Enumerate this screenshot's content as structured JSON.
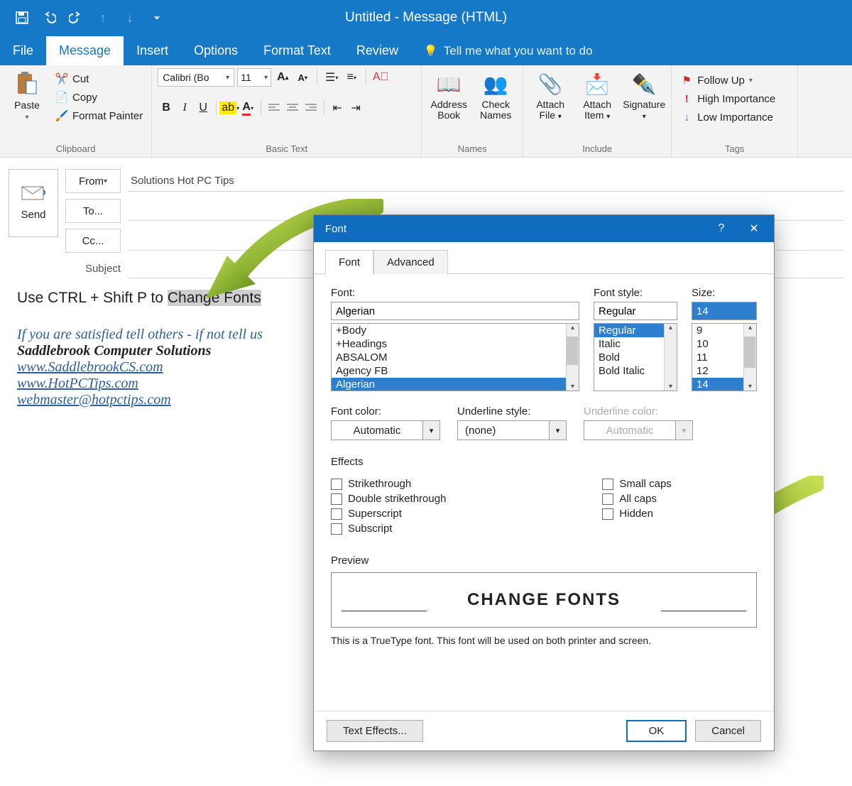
{
  "window": {
    "title": "Untitled - Message (HTML)"
  },
  "tabs": {
    "file": "File",
    "message": "Message",
    "insert": "Insert",
    "options": "Options",
    "format_text": "Format Text",
    "review": "Review",
    "tell_me": "Tell me what you want to do"
  },
  "ribbon": {
    "paste": "Paste",
    "cut": "Cut",
    "copy": "Copy",
    "format_painter": "Format Painter",
    "clipboard_label": "Clipboard",
    "font_name": "Calibri (Bo",
    "font_size": "11",
    "basic_text_label": "Basic Text",
    "address_book": "Address Book",
    "check_names": "Check Names",
    "names_label": "Names",
    "attach_file": "Attach File",
    "attach_item": "Attach Item",
    "signature": "Signature",
    "include_label": "Include",
    "follow_up": "Follow Up",
    "high_importance": "High Importance",
    "low_importance": "Low Importance",
    "tags_label": "Tags"
  },
  "compose": {
    "send": "Send",
    "from": "From",
    "to": "To...",
    "cc": "Cc...",
    "subject": "Subject",
    "from_value": "Solutions Hot PC Tips"
  },
  "body": {
    "line1_a": "Use CTRL + Shift P to ",
    "line1_b": "Change Fonts",
    "sig1": "If you are satisfied tell others - if not tell us",
    "sig2": "Saddlebrook Computer Solutions",
    "link1": "www.SaddlebrookCS.com",
    "link2": "www.HotPCTips.com",
    "link3": "webmaster@hotpctips.com"
  },
  "dialog": {
    "title": "Font",
    "tab_font": "Font",
    "tab_advanced": "Advanced",
    "font_label": "Font:",
    "font_value": "Algerian",
    "font_list": [
      "+Body",
      "+Headings",
      "ABSALOM",
      "Agency FB",
      "Algerian"
    ],
    "style_label": "Font style:",
    "style_value": "Regular",
    "style_list": [
      "Regular",
      "Italic",
      "Bold",
      "Bold Italic"
    ],
    "size_label": "Size:",
    "size_value": "14",
    "size_list": [
      "9",
      "10",
      "11",
      "12",
      "14"
    ],
    "font_color_label": "Font color:",
    "font_color_value": "Automatic",
    "underline_style_label": "Underline style:",
    "underline_style_value": "(none)",
    "underline_color_label": "Underline color:",
    "underline_color_value": "Automatic",
    "effects_label": "Effects",
    "strike": "Strikethrough",
    "dstrike": "Double strikethrough",
    "super": "Superscript",
    "sub": "Subscript",
    "smallcaps": "Small caps",
    "allcaps": "All caps",
    "hidden": "Hidden",
    "preview_label": "Preview",
    "preview_text": "CHANGE FONTS",
    "preview_note": "This is a TrueType font. This font will be used on both printer and screen.",
    "text_effects": "Text Effects...",
    "ok": "OK",
    "cancel": "Cancel"
  }
}
